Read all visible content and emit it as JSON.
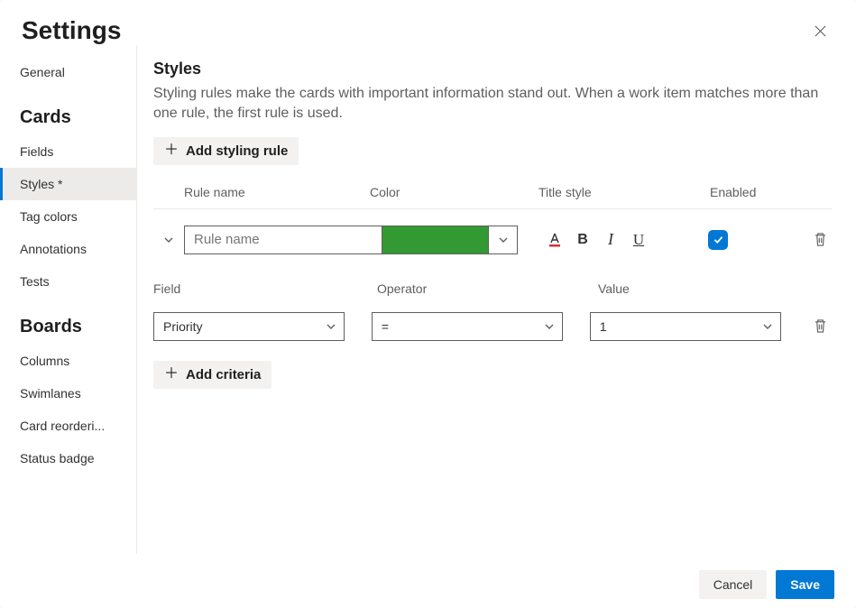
{
  "header": {
    "title": "Settings"
  },
  "sidebar": {
    "general": "General",
    "groups": [
      {
        "title": "Cards",
        "items": [
          {
            "label": "Fields",
            "selected": false
          },
          {
            "label": "Styles *",
            "selected": true
          },
          {
            "label": "Tag colors",
            "selected": false
          },
          {
            "label": "Annotations",
            "selected": false
          },
          {
            "label": "Tests",
            "selected": false
          }
        ]
      },
      {
        "title": "Boards",
        "items": [
          {
            "label": "Columns",
            "selected": false
          },
          {
            "label": "Swimlanes",
            "selected": false
          },
          {
            "label": "Card reorderi...",
            "selected": false
          },
          {
            "label": "Status badge",
            "selected": false
          }
        ]
      }
    ]
  },
  "main": {
    "section_title": "Styles",
    "section_desc": "Styling rules make the cards with important information stand out. When a work item matches more than one rule, the first rule is used.",
    "add_rule_label": "Add styling rule",
    "column_headers": {
      "name": "Rule name",
      "color": "Color",
      "title_style": "Title style",
      "enabled": "Enabled"
    },
    "rule": {
      "name_placeholder": "Rule name",
      "name_value": "",
      "color": "#339933",
      "enabled": true
    },
    "criteria_headers": {
      "field": "Field",
      "operator": "Operator",
      "value": "Value"
    },
    "criteria": {
      "field": "Priority",
      "operator": "=",
      "value": "1"
    },
    "add_criteria_label": "Add criteria"
  },
  "footer": {
    "cancel": "Cancel",
    "save": "Save"
  }
}
